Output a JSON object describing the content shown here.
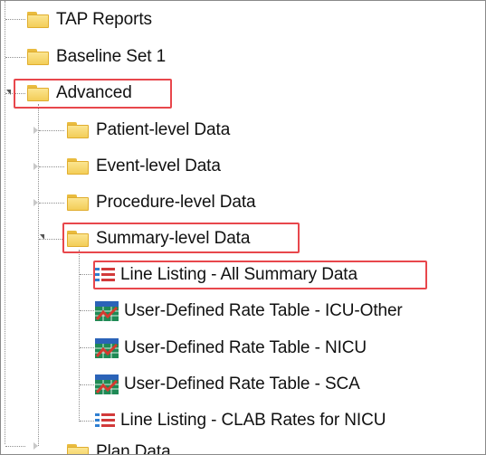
{
  "tree": {
    "top_items": [
      {
        "label": "TAP Reports",
        "icon": "folder-icon"
      },
      {
        "label": "Baseline Set 1",
        "icon": "folder-icon"
      },
      {
        "label": "Advanced",
        "icon": "folder-icon",
        "expanded": true,
        "highlighted": true
      }
    ],
    "advanced_children": [
      {
        "label": "Patient-level Data",
        "icon": "folder-icon"
      },
      {
        "label": "Event-level Data",
        "icon": "folder-icon"
      },
      {
        "label": "Procedure-level Data",
        "icon": "folder-icon"
      },
      {
        "label": "Summary-level Data",
        "icon": "folder-icon",
        "expanded": true,
        "highlighted": true
      }
    ],
    "summary_children": [
      {
        "label": "Line Listing - All Summary Data",
        "icon": "line-listing-icon",
        "highlighted": true
      },
      {
        "label": "User-Defined Rate Table - ICU-Other",
        "icon": "rate-table-icon"
      },
      {
        "label": "User-Defined Rate Table - NICU",
        "icon": "rate-table-icon"
      },
      {
        "label": "User-Defined Rate Table - SCA",
        "icon": "rate-table-icon"
      },
      {
        "label": "Line Listing - CLAB Rates for NICU",
        "icon": "line-listing-icon"
      }
    ],
    "bottom_item": {
      "label": "Plan Data",
      "icon": "folder-icon"
    }
  },
  "colors": {
    "highlight_border": "#e8474c",
    "folder_fill": "#f3cd58",
    "list_bullet": "#2f7fd1",
    "list_line": "#d23a3a",
    "chart_green": "#1f8a55",
    "chart_blue": "#2b63b8",
    "chart_red": "#d43a2f"
  }
}
